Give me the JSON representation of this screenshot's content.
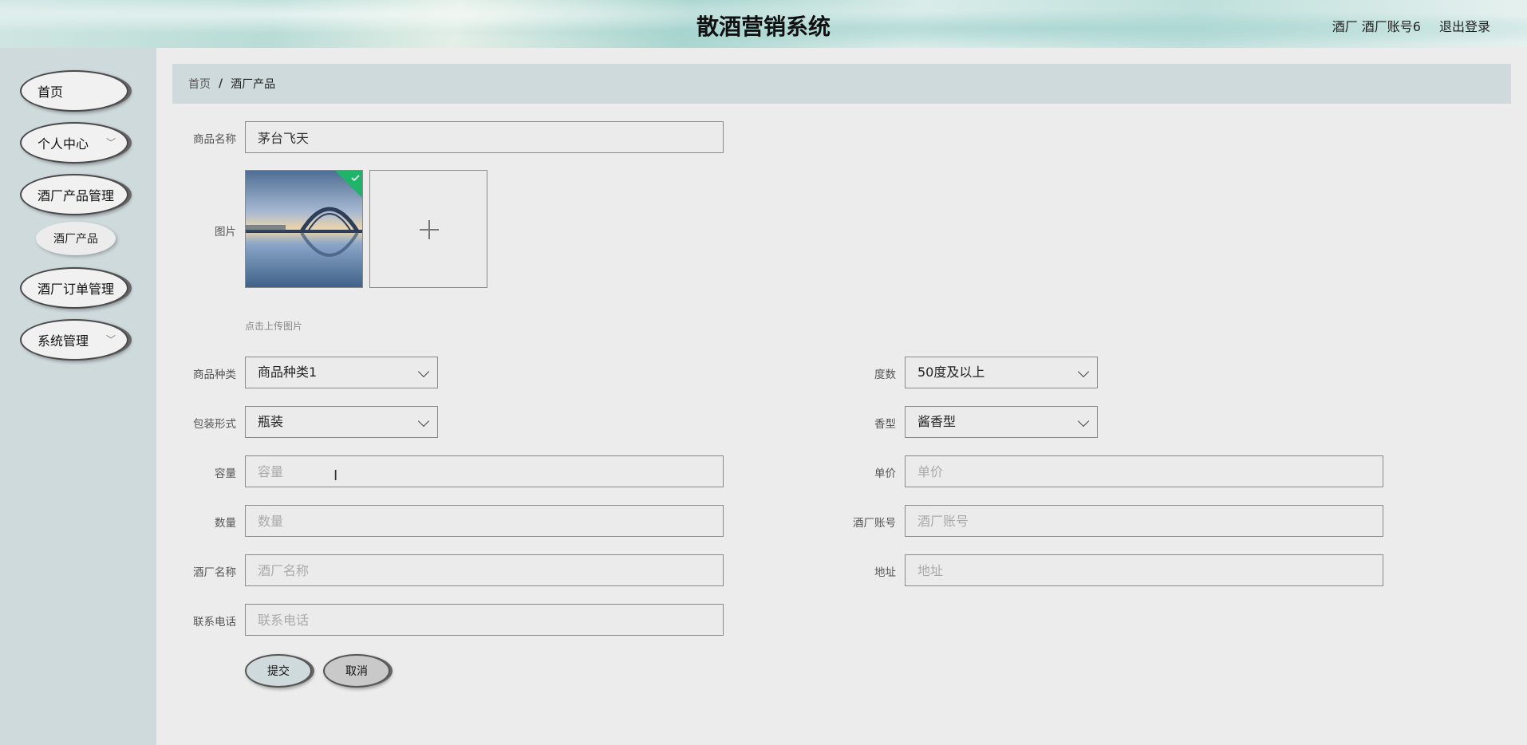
{
  "header": {
    "title": "散酒营销系统",
    "user": "酒厂 酒厂账号6",
    "logout": "退出登录"
  },
  "sidebar": {
    "items": [
      {
        "label": "首页"
      },
      {
        "label": "个人中心",
        "has_children": true
      },
      {
        "label": "酒厂产品管理"
      },
      {
        "label": "酒厂订单管理"
      },
      {
        "label": "系统管理",
        "has_children": true
      }
    ],
    "sub_item": {
      "label": "酒厂产品"
    }
  },
  "breadcrumb": {
    "home": "首页",
    "separator": "/",
    "current": "酒厂产品"
  },
  "form": {
    "name": {
      "label": "商品名称",
      "value": "茅台飞天"
    },
    "image": {
      "label": "图片",
      "hint": "点击上传图片",
      "uploaded": true
    },
    "category": {
      "label": "商品种类",
      "value": "商品种类1"
    },
    "degree": {
      "label": "度数",
      "value": "50度及以上"
    },
    "packaging": {
      "label": "包装形式",
      "value": "瓶装"
    },
    "aroma": {
      "label": "香型",
      "value": "酱香型"
    },
    "capacity": {
      "label": "容量",
      "placeholder": "容量"
    },
    "price": {
      "label": "单价",
      "placeholder": "单价"
    },
    "quantity": {
      "label": "数量",
      "placeholder": "数量"
    },
    "account": {
      "label": "酒厂账号",
      "placeholder": "酒厂账号"
    },
    "factory_name": {
      "label": "酒厂名称",
      "placeholder": "酒厂名称"
    },
    "address": {
      "label": "地址",
      "placeholder": "地址"
    },
    "phone": {
      "label": "联系电话",
      "placeholder": "联系电话"
    }
  },
  "buttons": {
    "submit": "提交",
    "cancel": "取消"
  },
  "colors": {
    "sidebar_bg": "#cfdadd",
    "page_bg": "#ececec",
    "success_badge": "#1fb46a"
  }
}
